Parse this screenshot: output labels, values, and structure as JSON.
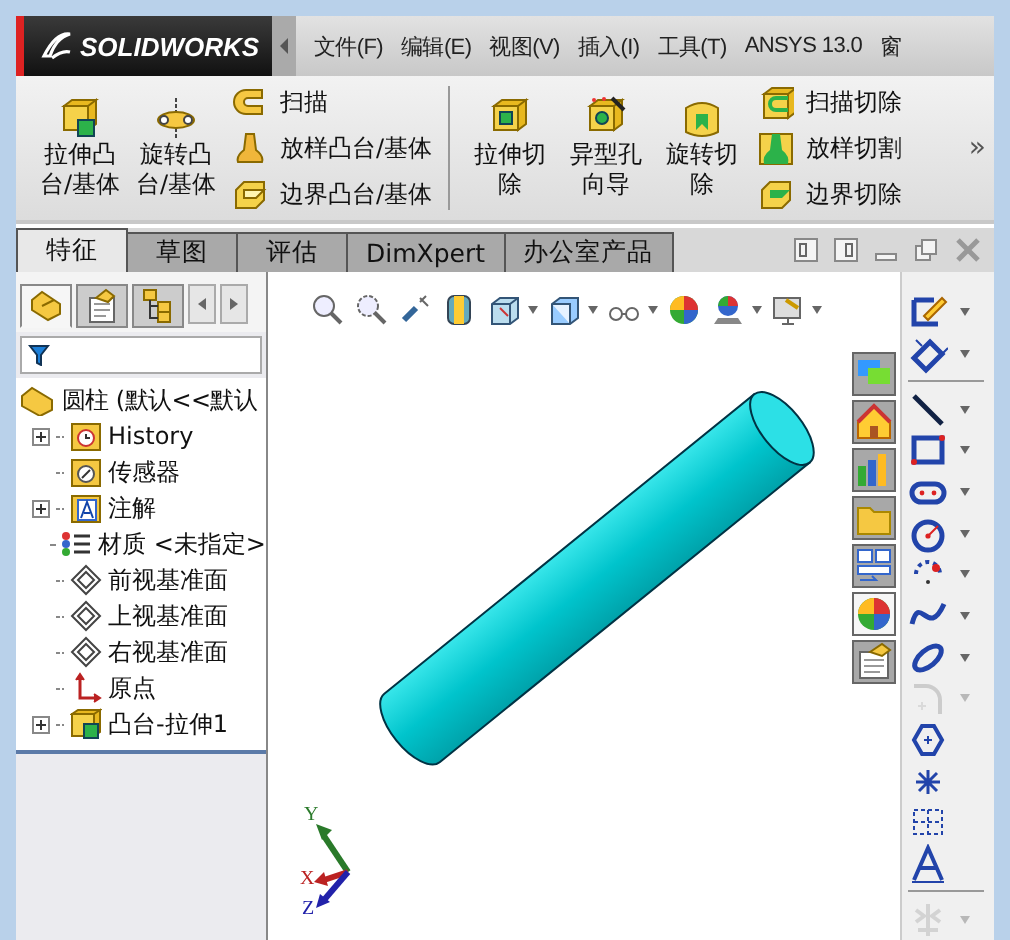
{
  "menu_bar": {
    "logo": "SOLIDWORKS",
    "items": [
      "文件(F)",
      "编辑(E)",
      "视图(V)",
      "插入(I)",
      "工具(T)",
      "ANSYS 13.0",
      "窗"
    ]
  },
  "ribbon": {
    "groups": [
      {
        "kind": "large",
        "buttons": [
          {
            "label": "拉伸凸台/基体",
            "kind": "extrude"
          },
          {
            "label": "旋转凸台/基体",
            "kind": "revolve"
          }
        ]
      },
      {
        "kind": "stack",
        "buttons": [
          {
            "label": "扫描",
            "kind": "sweep"
          },
          {
            "label": "放样凸台/基体",
            "kind": "loft"
          },
          {
            "label": "边界凸台/基体",
            "kind": "boundary"
          }
        ]
      },
      {
        "kind": "separator"
      },
      {
        "kind": "large",
        "buttons": [
          {
            "label": "拉伸切除",
            "kind": "extrude-cut"
          },
          {
            "label": "异型孔向导",
            "kind": "hole"
          },
          {
            "label": "旋转切除",
            "kind": "revolve-cut"
          }
        ]
      },
      {
        "kind": "stack",
        "buttons": [
          {
            "label": "扫描切除",
            "kind": "sweep-cut"
          },
          {
            "label": "放样切割",
            "kind": "loft-cut"
          },
          {
            "label": "边界切除",
            "kind": "boundary-cut"
          }
        ]
      }
    ],
    "more": "»"
  },
  "feature_tabs": [
    {
      "label": "特征",
      "selected": true
    },
    {
      "label": "草图",
      "selected": false
    },
    {
      "label": "评估",
      "selected": false
    },
    {
      "label": "DimXpert",
      "selected": false
    },
    {
      "label": "办公室产品",
      "selected": false
    }
  ],
  "panel_tabs": [
    {
      "kind": "feature-manager",
      "selected": true
    },
    {
      "kind": "property-manager",
      "selected": false
    },
    {
      "kind": "configuration-manager",
      "selected": false
    }
  ],
  "feature_tree": {
    "label": "圆柱 (默认<<默认",
    "children": [
      {
        "label": "History",
        "kind": "history",
        "expandable": true
      },
      {
        "label": "传感器",
        "kind": "sensor",
        "expandable": false
      },
      {
        "label": "注解",
        "kind": "annotation",
        "expandable": true
      },
      {
        "label": "材质 <未指定>",
        "kind": "material",
        "expandable": false
      },
      {
        "label": "前视基准面",
        "kind": "plane",
        "expandable": false
      },
      {
        "label": "上视基准面",
        "kind": "plane",
        "expandable": false
      },
      {
        "label": "右视基准面",
        "kind": "plane",
        "expandable": false
      },
      {
        "label": "原点",
        "kind": "origin",
        "expandable": false
      },
      {
        "label": "凸台-拉伸1",
        "kind": "feature",
        "expandable": true
      }
    ]
  },
  "view_tools": [
    {
      "kind": "zoom-fit",
      "dropdown": false
    },
    {
      "kind": "zoom-area",
      "dropdown": false
    },
    {
      "kind": "previous",
      "dropdown": false
    },
    {
      "kind": "section",
      "dropdown": false
    },
    {
      "kind": "orientation",
      "dropdown": true
    },
    {
      "kind": "display-style",
      "dropdown": true
    },
    {
      "kind": "hide-show",
      "dropdown": true
    },
    {
      "kind": "appearance",
      "dropdown": false
    },
    {
      "kind": "scene",
      "dropdown": true
    },
    {
      "kind": "settings",
      "dropdown": true
    }
  ],
  "task_pane": [
    {
      "kind": "resources",
      "selected": false
    },
    {
      "kind": "home",
      "selected": false
    },
    {
      "kind": "library",
      "selected": false
    },
    {
      "kind": "folder",
      "selected": false
    },
    {
      "kind": "view-palette",
      "selected": false
    },
    {
      "kind": "appearances",
      "selected": true
    },
    {
      "kind": "properties",
      "selected": false
    }
  ],
  "triad": {
    "x": "X",
    "y": "Y",
    "z": "Z"
  },
  "sketch_tools": [
    {
      "kind": "sketch",
      "disabled": false,
      "dropdown": true
    },
    {
      "kind": "dimension",
      "disabled": false,
      "dropdown": true
    },
    {
      "kind": "divider"
    },
    {
      "kind": "line",
      "disabled": false,
      "dropdown": true
    },
    {
      "kind": "rectangle",
      "disabled": false,
      "dropdown": true
    },
    {
      "kind": "slot",
      "disabled": false,
      "dropdown": true
    },
    {
      "kind": "circle",
      "disabled": false,
      "dropdown": true
    },
    {
      "kind": "arc",
      "disabled": false,
      "dropdown": true
    },
    {
      "kind": "spline",
      "disabled": false,
      "dropdown": true
    },
    {
      "kind": "ellipse",
      "disabled": false,
      "dropdown": true
    },
    {
      "kind": "fillet",
      "disabled": true,
      "dropdown": true
    },
    {
      "kind": "polygon",
      "disabled": false,
      "dropdown": false
    },
    {
      "kind": "point",
      "disabled": false,
      "dropdown": false
    },
    {
      "kind": "grid",
      "disabled": false,
      "dropdown": false
    },
    {
      "kind": "text",
      "disabled": false,
      "dropdown": false
    },
    {
      "kind": "divider"
    },
    {
      "kind": "mirror",
      "disabled": true,
      "dropdown": true
    }
  ]
}
